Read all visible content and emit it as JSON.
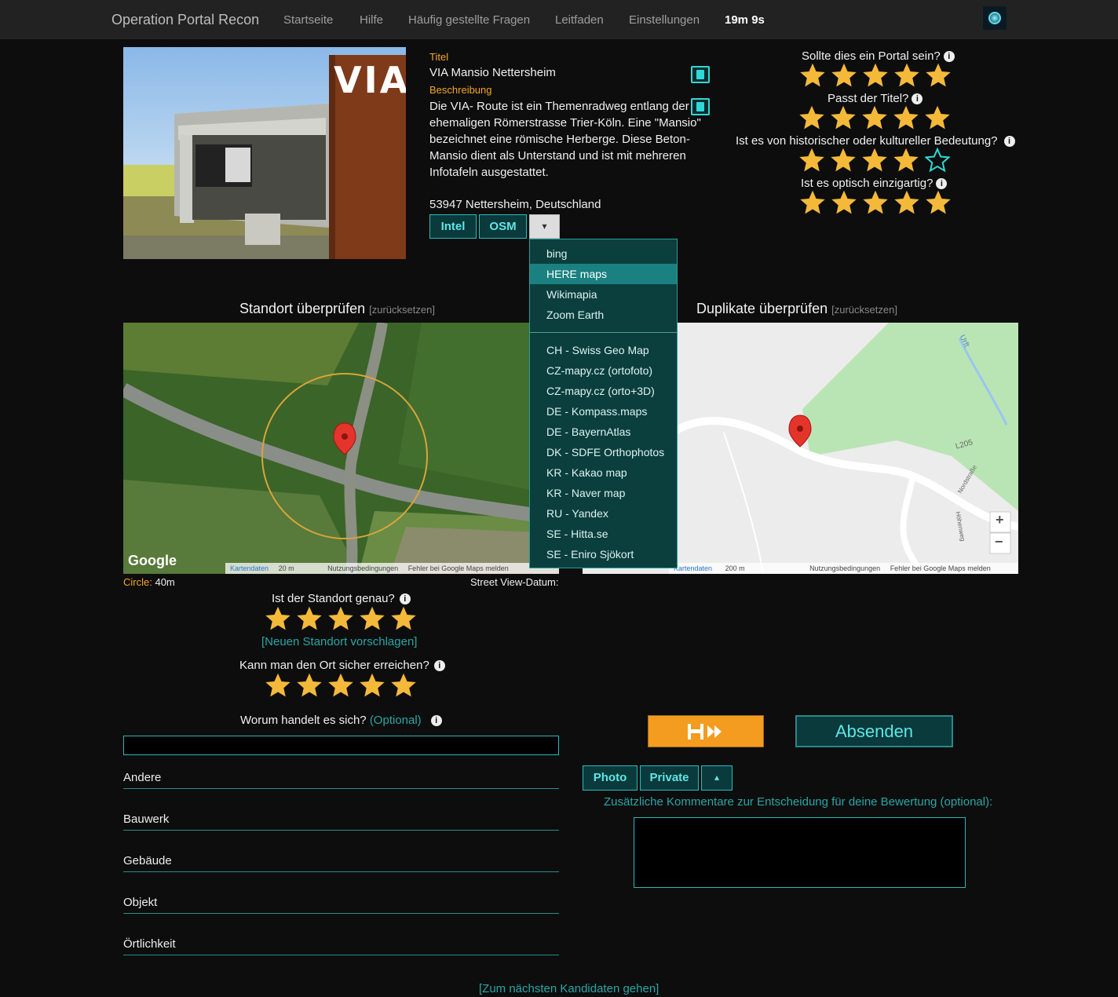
{
  "nav": {
    "brand": "Operation Portal Recon",
    "links": [
      "Startseite",
      "Hilfe",
      "Häufig gestellte Fragen",
      "Leitfaden",
      "Einstellungen"
    ],
    "timer": "19m 9s"
  },
  "candidate": {
    "title_label": "Titel",
    "title": "VIA Mansio Nettersheim",
    "description_label": "Beschreibung",
    "description": "Die VIA- Route ist ein Themenradweg entlang der ehemaligen Römerstrasse Trier-Köln. Eine \"Mansio\" bezeichnet eine römische Herberge. Diese Beton-Mansio dient als Unterstand und ist mit mehreren Infotafeln ausgestattet.",
    "address": "53947 Nettersheim, Deutschland",
    "photo_sign_text": "VIA"
  },
  "map_buttons": {
    "intel": "Intel",
    "osm": "OSM",
    "toggle": "▾"
  },
  "dropdown": {
    "top": [
      "bing",
      "HERE maps",
      "Wikimapia",
      "Zoom Earth"
    ],
    "active_item": "HERE maps",
    "bottom": [
      "CH - Swiss Geo Map",
      "CZ-mapy.cz (ortofoto)",
      "CZ-mapy.cz (orto+3D)",
      "DE - Kompass.maps",
      "DE - BayernAtlas",
      "DK - SDFE Orthophotos",
      "KR - Kakao map",
      "KR - Naver map",
      "RU - Yandex",
      "SE - Hitta.se",
      "SE - Eniro Sjökort"
    ]
  },
  "ratings": {
    "portal": {
      "label": "Sollte dies ein Portal sein?",
      "value": 5
    },
    "title": {
      "label": "Passt der Titel?",
      "value": 5
    },
    "historic": {
      "label": "Ist es von historischer oder kultureller Bedeutung?",
      "value": 4
    },
    "visual": {
      "label": "Ist es optisch einzigartig?",
      "value": 5
    },
    "location": {
      "label": "Ist der Standort genau?",
      "value": 5
    },
    "safe": {
      "label": "Kann man den Ort sicher erreichen?",
      "value": 5
    }
  },
  "location_section": {
    "heading": "Standort überprüfen",
    "reset": "[zurücksetzen]"
  },
  "duplicates_section": {
    "heading": "Duplikate überprüfen",
    "reset": "[zurücksetzen]"
  },
  "map1": {
    "google": "Google",
    "footer": [
      "Kartendaten",
      "20 m",
      "Nutzungsbedingungen",
      "Fehler bei Google Maps melden"
    ]
  },
  "map2": {
    "footer": [
      "Kartendaten",
      "200 m",
      "Nutzungsbedingungen",
      "Fehler bei Google Maps melden"
    ],
    "road_labels": [
      "L205",
      "Urft",
      "Nordstraße",
      "Höhenweg"
    ],
    "zoom_in": "+",
    "zoom_out": "−"
  },
  "circle": {
    "label": "Circle:",
    "value": "40m"
  },
  "streetview_label": "Street View-Datum:",
  "suggest_location": "[Neuen Standort vorschlagen]",
  "what_is_it": {
    "label": "Worum handelt es sich?",
    "optional": "(Optional)"
  },
  "categories": [
    "Andere",
    "Bauwerk",
    "Gebäude",
    "Objekt",
    "Örtlichkeit"
  ],
  "actions": {
    "submit": "Absenden"
  },
  "comment_buttons": {
    "photo": "Photo",
    "private": "Private",
    "toggle": "▴"
  },
  "comment_label": "Zusätzliche Kommentare zur Entscheidung für deine Bewertung (optional):",
  "next_candidate": "[Zum nächsten Kandidaten gehen]",
  "colors": {
    "accent": "#2ed8d8",
    "star": "#f5b93a",
    "orange": "#f5a623"
  }
}
